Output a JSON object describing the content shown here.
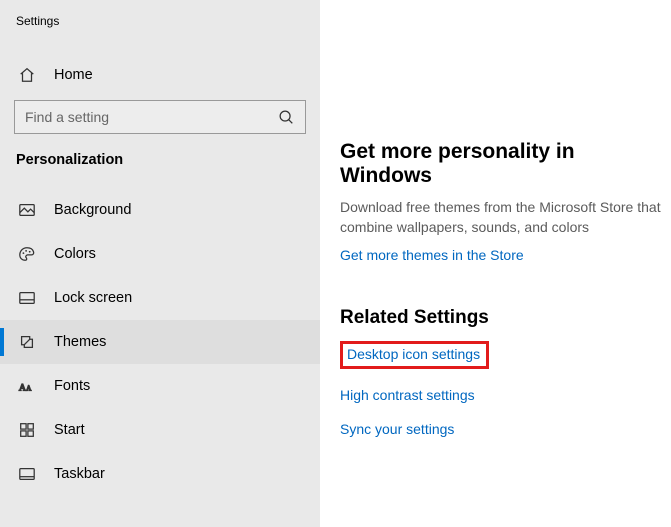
{
  "window": {
    "title": "Settings"
  },
  "sidebar": {
    "home_label": "Home",
    "search_placeholder": "Find a setting",
    "section": "Personalization",
    "items": [
      {
        "id": "background",
        "label": "Background"
      },
      {
        "id": "colors",
        "label": "Colors"
      },
      {
        "id": "lockscreen",
        "label": "Lock screen"
      },
      {
        "id": "themes",
        "label": "Themes",
        "selected": true
      },
      {
        "id": "fonts",
        "label": "Fonts"
      },
      {
        "id": "start",
        "label": "Start"
      },
      {
        "id": "taskbar",
        "label": "Taskbar"
      }
    ]
  },
  "main": {
    "heading": "Get more personality in Windows",
    "subtext": "Download free themes from the Microsoft Store that combine wallpapers, sounds, and colors",
    "store_link": "Get more themes in the Store",
    "related_heading": "Related Settings",
    "links": {
      "desktop_icon": "Desktop icon settings",
      "high_contrast": "High contrast settings",
      "sync": "Sync your settings"
    }
  }
}
